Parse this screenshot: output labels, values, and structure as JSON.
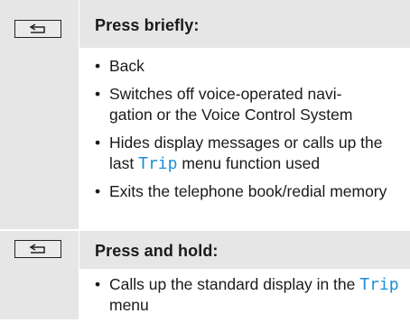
{
  "rows": [
    {
      "icon": "back-key-icon",
      "heading": "Press briefly:",
      "items": [
        {
          "pre": "Back",
          "link": "",
          "post": ""
        },
        {
          "pre": "Switches off voice-operated navi-gation or the Voice Control System",
          "link": "",
          "post": ""
        },
        {
          "pre": "Hides display messages or calls up the last ",
          "link": "Trip",
          "post": " menu function used"
        },
        {
          "pre": "Exits the telephone book/redial memory",
          "link": "",
          "post": ""
        }
      ]
    },
    {
      "icon": "back-key-icon",
      "heading": "Press and hold:",
      "items": [
        {
          "pre": "Calls up the standard display in the ",
          "link": "Trip",
          "post": " menu"
        }
      ]
    }
  ],
  "colors": {
    "shade": "#e6e6e6",
    "link": "#1a8fd8"
  }
}
